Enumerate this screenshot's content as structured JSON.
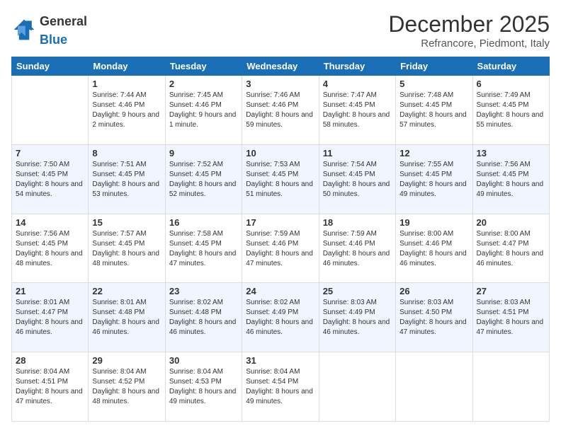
{
  "header": {
    "logo_general": "General",
    "logo_blue": "Blue",
    "month_year": "December 2025",
    "location": "Refrancore, Piedmont, Italy"
  },
  "weekdays": [
    "Sunday",
    "Monday",
    "Tuesday",
    "Wednesday",
    "Thursday",
    "Friday",
    "Saturday"
  ],
  "weeks": [
    [
      {
        "day": "",
        "sunrise": "",
        "sunset": "",
        "daylight": ""
      },
      {
        "day": "1",
        "sunrise": "Sunrise: 7:44 AM",
        "sunset": "Sunset: 4:46 PM",
        "daylight": "Daylight: 9 hours and 2 minutes."
      },
      {
        "day": "2",
        "sunrise": "Sunrise: 7:45 AM",
        "sunset": "Sunset: 4:46 PM",
        "daylight": "Daylight: 9 hours and 1 minute."
      },
      {
        "day": "3",
        "sunrise": "Sunrise: 7:46 AM",
        "sunset": "Sunset: 4:46 PM",
        "daylight": "Daylight: 8 hours and 59 minutes."
      },
      {
        "day": "4",
        "sunrise": "Sunrise: 7:47 AM",
        "sunset": "Sunset: 4:45 PM",
        "daylight": "Daylight: 8 hours and 58 minutes."
      },
      {
        "day": "5",
        "sunrise": "Sunrise: 7:48 AM",
        "sunset": "Sunset: 4:45 PM",
        "daylight": "Daylight: 8 hours and 57 minutes."
      },
      {
        "day": "6",
        "sunrise": "Sunrise: 7:49 AM",
        "sunset": "Sunset: 4:45 PM",
        "daylight": "Daylight: 8 hours and 55 minutes."
      }
    ],
    [
      {
        "day": "7",
        "sunrise": "Sunrise: 7:50 AM",
        "sunset": "Sunset: 4:45 PM",
        "daylight": "Daylight: 8 hours and 54 minutes."
      },
      {
        "day": "8",
        "sunrise": "Sunrise: 7:51 AM",
        "sunset": "Sunset: 4:45 PM",
        "daylight": "Daylight: 8 hours and 53 minutes."
      },
      {
        "day": "9",
        "sunrise": "Sunrise: 7:52 AM",
        "sunset": "Sunset: 4:45 PM",
        "daylight": "Daylight: 8 hours and 52 minutes."
      },
      {
        "day": "10",
        "sunrise": "Sunrise: 7:53 AM",
        "sunset": "Sunset: 4:45 PM",
        "daylight": "Daylight: 8 hours and 51 minutes."
      },
      {
        "day": "11",
        "sunrise": "Sunrise: 7:54 AM",
        "sunset": "Sunset: 4:45 PM",
        "daylight": "Daylight: 8 hours and 50 minutes."
      },
      {
        "day": "12",
        "sunrise": "Sunrise: 7:55 AM",
        "sunset": "Sunset: 4:45 PM",
        "daylight": "Daylight: 8 hours and 49 minutes."
      },
      {
        "day": "13",
        "sunrise": "Sunrise: 7:56 AM",
        "sunset": "Sunset: 4:45 PM",
        "daylight": "Daylight: 8 hours and 49 minutes."
      }
    ],
    [
      {
        "day": "14",
        "sunrise": "Sunrise: 7:56 AM",
        "sunset": "Sunset: 4:45 PM",
        "daylight": "Daylight: 8 hours and 48 minutes."
      },
      {
        "day": "15",
        "sunrise": "Sunrise: 7:57 AM",
        "sunset": "Sunset: 4:45 PM",
        "daylight": "Daylight: 8 hours and 48 minutes."
      },
      {
        "day": "16",
        "sunrise": "Sunrise: 7:58 AM",
        "sunset": "Sunset: 4:45 PM",
        "daylight": "Daylight: 8 hours and 47 minutes."
      },
      {
        "day": "17",
        "sunrise": "Sunrise: 7:59 AM",
        "sunset": "Sunset: 4:46 PM",
        "daylight": "Daylight: 8 hours and 47 minutes."
      },
      {
        "day": "18",
        "sunrise": "Sunrise: 7:59 AM",
        "sunset": "Sunset: 4:46 PM",
        "daylight": "Daylight: 8 hours and 46 minutes."
      },
      {
        "day": "19",
        "sunrise": "Sunrise: 8:00 AM",
        "sunset": "Sunset: 4:46 PM",
        "daylight": "Daylight: 8 hours and 46 minutes."
      },
      {
        "day": "20",
        "sunrise": "Sunrise: 8:00 AM",
        "sunset": "Sunset: 4:47 PM",
        "daylight": "Daylight: 8 hours and 46 minutes."
      }
    ],
    [
      {
        "day": "21",
        "sunrise": "Sunrise: 8:01 AM",
        "sunset": "Sunset: 4:47 PM",
        "daylight": "Daylight: 8 hours and 46 minutes."
      },
      {
        "day": "22",
        "sunrise": "Sunrise: 8:01 AM",
        "sunset": "Sunset: 4:48 PM",
        "daylight": "Daylight: 8 hours and 46 minutes."
      },
      {
        "day": "23",
        "sunrise": "Sunrise: 8:02 AM",
        "sunset": "Sunset: 4:48 PM",
        "daylight": "Daylight: 8 hours and 46 minutes."
      },
      {
        "day": "24",
        "sunrise": "Sunrise: 8:02 AM",
        "sunset": "Sunset: 4:49 PM",
        "daylight": "Daylight: 8 hours and 46 minutes."
      },
      {
        "day": "25",
        "sunrise": "Sunrise: 8:03 AM",
        "sunset": "Sunset: 4:49 PM",
        "daylight": "Daylight: 8 hours and 46 minutes."
      },
      {
        "day": "26",
        "sunrise": "Sunrise: 8:03 AM",
        "sunset": "Sunset: 4:50 PM",
        "daylight": "Daylight: 8 hours and 47 minutes."
      },
      {
        "day": "27",
        "sunrise": "Sunrise: 8:03 AM",
        "sunset": "Sunset: 4:51 PM",
        "daylight": "Daylight: 8 hours and 47 minutes."
      }
    ],
    [
      {
        "day": "28",
        "sunrise": "Sunrise: 8:04 AM",
        "sunset": "Sunset: 4:51 PM",
        "daylight": "Daylight: 8 hours and 47 minutes."
      },
      {
        "day": "29",
        "sunrise": "Sunrise: 8:04 AM",
        "sunset": "Sunset: 4:52 PM",
        "daylight": "Daylight: 8 hours and 48 minutes."
      },
      {
        "day": "30",
        "sunrise": "Sunrise: 8:04 AM",
        "sunset": "Sunset: 4:53 PM",
        "daylight": "Daylight: 8 hours and 49 minutes."
      },
      {
        "day": "31",
        "sunrise": "Sunrise: 8:04 AM",
        "sunset": "Sunset: 4:54 PM",
        "daylight": "Daylight: 8 hours and 49 minutes."
      },
      {
        "day": "",
        "sunrise": "",
        "sunset": "",
        "daylight": ""
      },
      {
        "day": "",
        "sunrise": "",
        "sunset": "",
        "daylight": ""
      },
      {
        "day": "",
        "sunrise": "",
        "sunset": "",
        "daylight": ""
      }
    ]
  ]
}
